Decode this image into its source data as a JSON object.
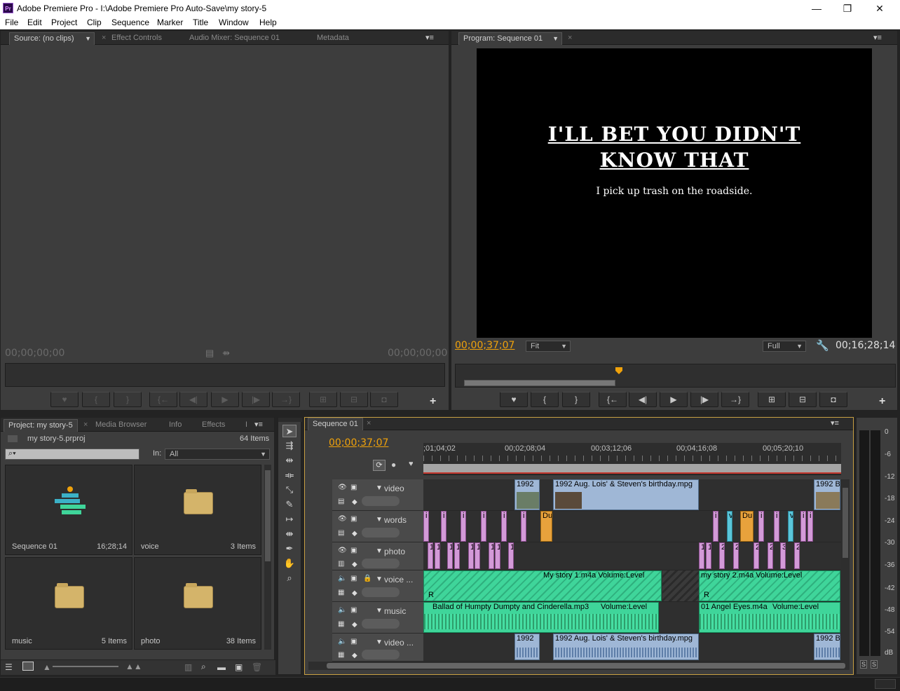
{
  "window": {
    "app_logo": "Pr",
    "title": "Adobe Premiere Pro - I:\\Adobe Premiere Pro Auto-Save\\my story-5",
    "minimize": "—",
    "maximize": "❐",
    "close": "✕"
  },
  "menu": [
    "File",
    "Edit",
    "Project",
    "Clip",
    "Sequence",
    "Marker",
    "Title",
    "Window",
    "Help"
  ],
  "source_panel": {
    "tabs": [
      "Source: (no clips)",
      "Effect Controls",
      "Audio Mixer: Sequence 01",
      "Metadata"
    ],
    "timecode_in": "00;00;00;00",
    "timecode_out": "00;00;00;00",
    "add_button": "+"
  },
  "program_panel": {
    "tab": "Program: Sequence 01",
    "title_line1": "I'LL BET YOU DIDN'T",
    "title_line2": "KNOW THAT",
    "subtitle": "I pick up trash on the roadside.",
    "timecode_current": "00;00;37;07",
    "zoom": "Fit",
    "resolution": "Full",
    "timecode_duration": "00;16;28;14",
    "add_button": "+"
  },
  "project_panel": {
    "tabs": [
      "Project: my story-5",
      "Media Browser",
      "Info",
      "Effects",
      "I"
    ],
    "project_file": "my story-5.prproj",
    "item_count": "64 Items",
    "in_label": "In:",
    "in_value": "All",
    "items": [
      {
        "name": "Sequence 01",
        "count": "16;28;14"
      },
      {
        "name": "voice",
        "count": "3 Items"
      },
      {
        "name": "music",
        "count": "5 Items"
      },
      {
        "name": "photo",
        "count": "38 Items"
      }
    ]
  },
  "timeline": {
    "tab": "Sequence 01",
    "timecode": "00;00;37;07",
    "ruler": [
      ";01;04;02",
      "00;02;08;04",
      "00;03;12;06",
      "00;04;16;08",
      "00;05;20;10"
    ],
    "tracks": [
      {
        "name": "video"
      },
      {
        "name": "words"
      },
      {
        "name": "photo"
      },
      {
        "name": "voice ..."
      },
      {
        "name": "music"
      },
      {
        "name": "video ..."
      }
    ],
    "clips": {
      "v_1992_a": "1992",
      "v_main": "1992 Aug. Lois' & Steven's birthday.mpg",
      "v_1992_b": "1992 B",
      "words_du": "Du",
      "words_i": "i",
      "words_v": "v",
      "photo_1": "1",
      "photo_2": "2",
      "photo_3": "3",
      "voice_1": "My story 1.m4a  Volume:Level",
      "voice_2": "my story 2.m4a  Volume:Level",
      "voice_r": "R",
      "music_1": "Ballad of Humpty Dumpty and Cinderella.mp3",
      "music_1_vol": "Volume:Level",
      "music_2": "01 Angel Eyes.m4a",
      "music_2_vol": "Volume:Level",
      "av_1992_a": "1992",
      "av_main": "1992 Aug. Lois' & Steven's birthday.mpg",
      "av_1992_b": "1992 B"
    }
  },
  "vu_meter": {
    "labels": [
      "0",
      "-6",
      "-12",
      "-18",
      "-24",
      "-30",
      "-36",
      "-42",
      "-48",
      "-54",
      "dB"
    ],
    "solo": "S"
  },
  "colors": {
    "timecode": "#f0a20b",
    "video_clip": "#9fb7d6",
    "audio_clip": "#3fd59a",
    "marker_clip": "#d39ad8"
  }
}
